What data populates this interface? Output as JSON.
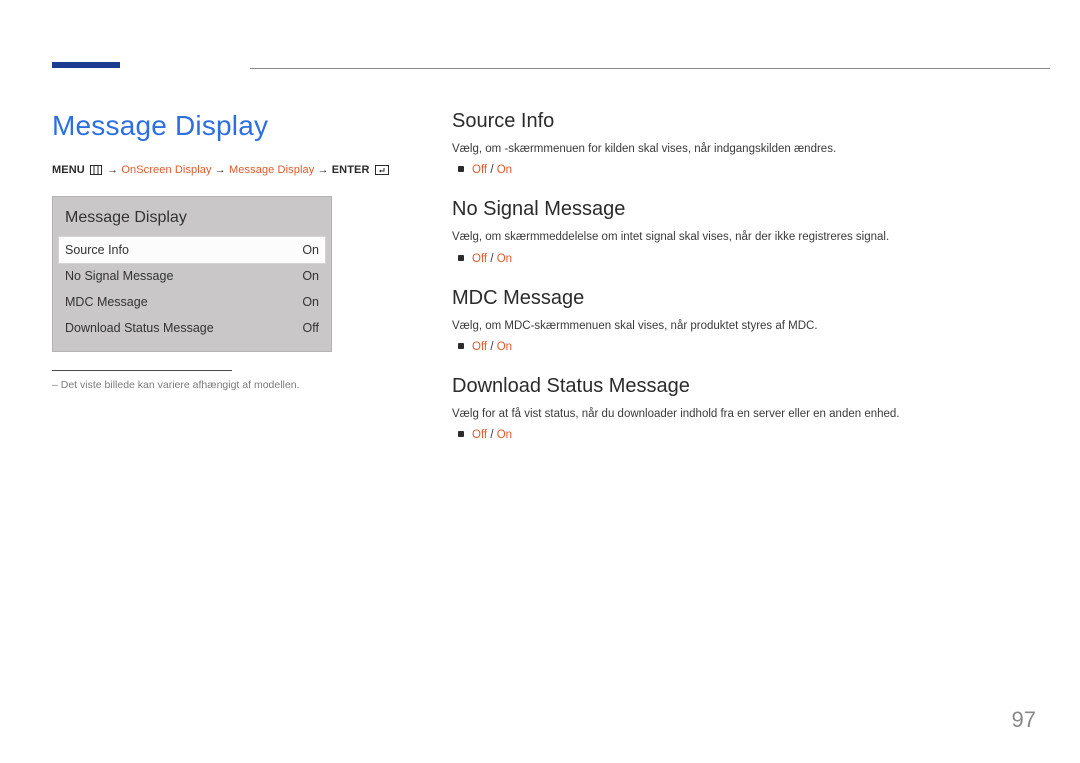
{
  "page_number": "97",
  "left": {
    "title": "Message Display",
    "breadcrumb": {
      "menu": "MENU",
      "arrow": "→",
      "path1": "OnScreen Display",
      "path2": "Message Display",
      "enter": "ENTER"
    },
    "osd": {
      "title": "Message Display",
      "rows": [
        {
          "label": "Source Info",
          "value": "On",
          "selected": true
        },
        {
          "label": "No Signal Message",
          "value": "On",
          "selected": false
        },
        {
          "label": "MDC Message",
          "value": "On",
          "selected": false
        },
        {
          "label": "Download Status Message",
          "value": "Off",
          "selected": false
        }
      ]
    },
    "footnote": "– Det viste billede kan variere afhængigt af modellen."
  },
  "sections": [
    {
      "heading": "Source Info",
      "desc": "Vælg, om -skærmmenuen for kilden skal vises, når indgangskilden ændres.",
      "opt_off": "Off",
      "opt_sep": " / ",
      "opt_on": "On"
    },
    {
      "heading": "No Signal Message",
      "desc": "Vælg, om skærmmeddelelse om intet signal skal vises, når der ikke registreres signal.",
      "opt_off": "Off",
      "opt_sep": " / ",
      "opt_on": "On"
    },
    {
      "heading": "MDC Message",
      "desc": "Vælg, om MDC-skærmmenuen skal vises, når produktet styres af MDC.",
      "opt_off": "Off",
      "opt_sep": " / ",
      "opt_on": "On"
    },
    {
      "heading": "Download Status Message",
      "desc": "Vælg for at få vist status, når du downloader indhold fra en server eller en anden enhed.",
      "opt_off": "Off",
      "opt_sep": " / ",
      "opt_on": "On"
    }
  ]
}
